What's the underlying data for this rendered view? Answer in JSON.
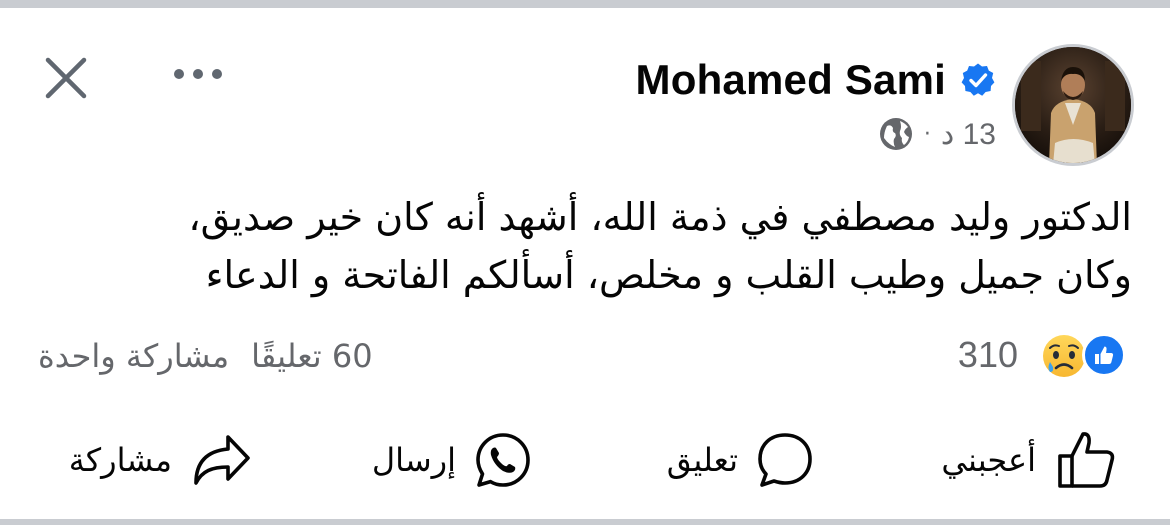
{
  "header": {
    "close_icon": "close-icon",
    "more_icon": "more-horizontal-icon"
  },
  "author": {
    "name": "Mohamed Sami",
    "verified_icon": "verified-badge-icon",
    "verified_color": "#1877f2"
  },
  "meta": {
    "time": "13 د",
    "separator": "·",
    "privacy_icon": "globe-icon"
  },
  "post": {
    "lines": [
      "الدكتور وليد مصطفي في ذمة الله، أشهد أنه كان خير صديق،",
      "وكان جميل وطيب القلب و مخلص، أسألكم الفاتحة و الدعاء"
    ]
  },
  "reactions": {
    "count": "310",
    "types": [
      "like",
      "sad"
    ],
    "like_color": "#1877f2"
  },
  "stats": {
    "comments": "60 تعليقًا",
    "shares": "مشاركة واحدة"
  },
  "actions": {
    "like": "أعجبني",
    "comment": "تعليق",
    "send": "إرسال",
    "share": "مشاركة"
  }
}
